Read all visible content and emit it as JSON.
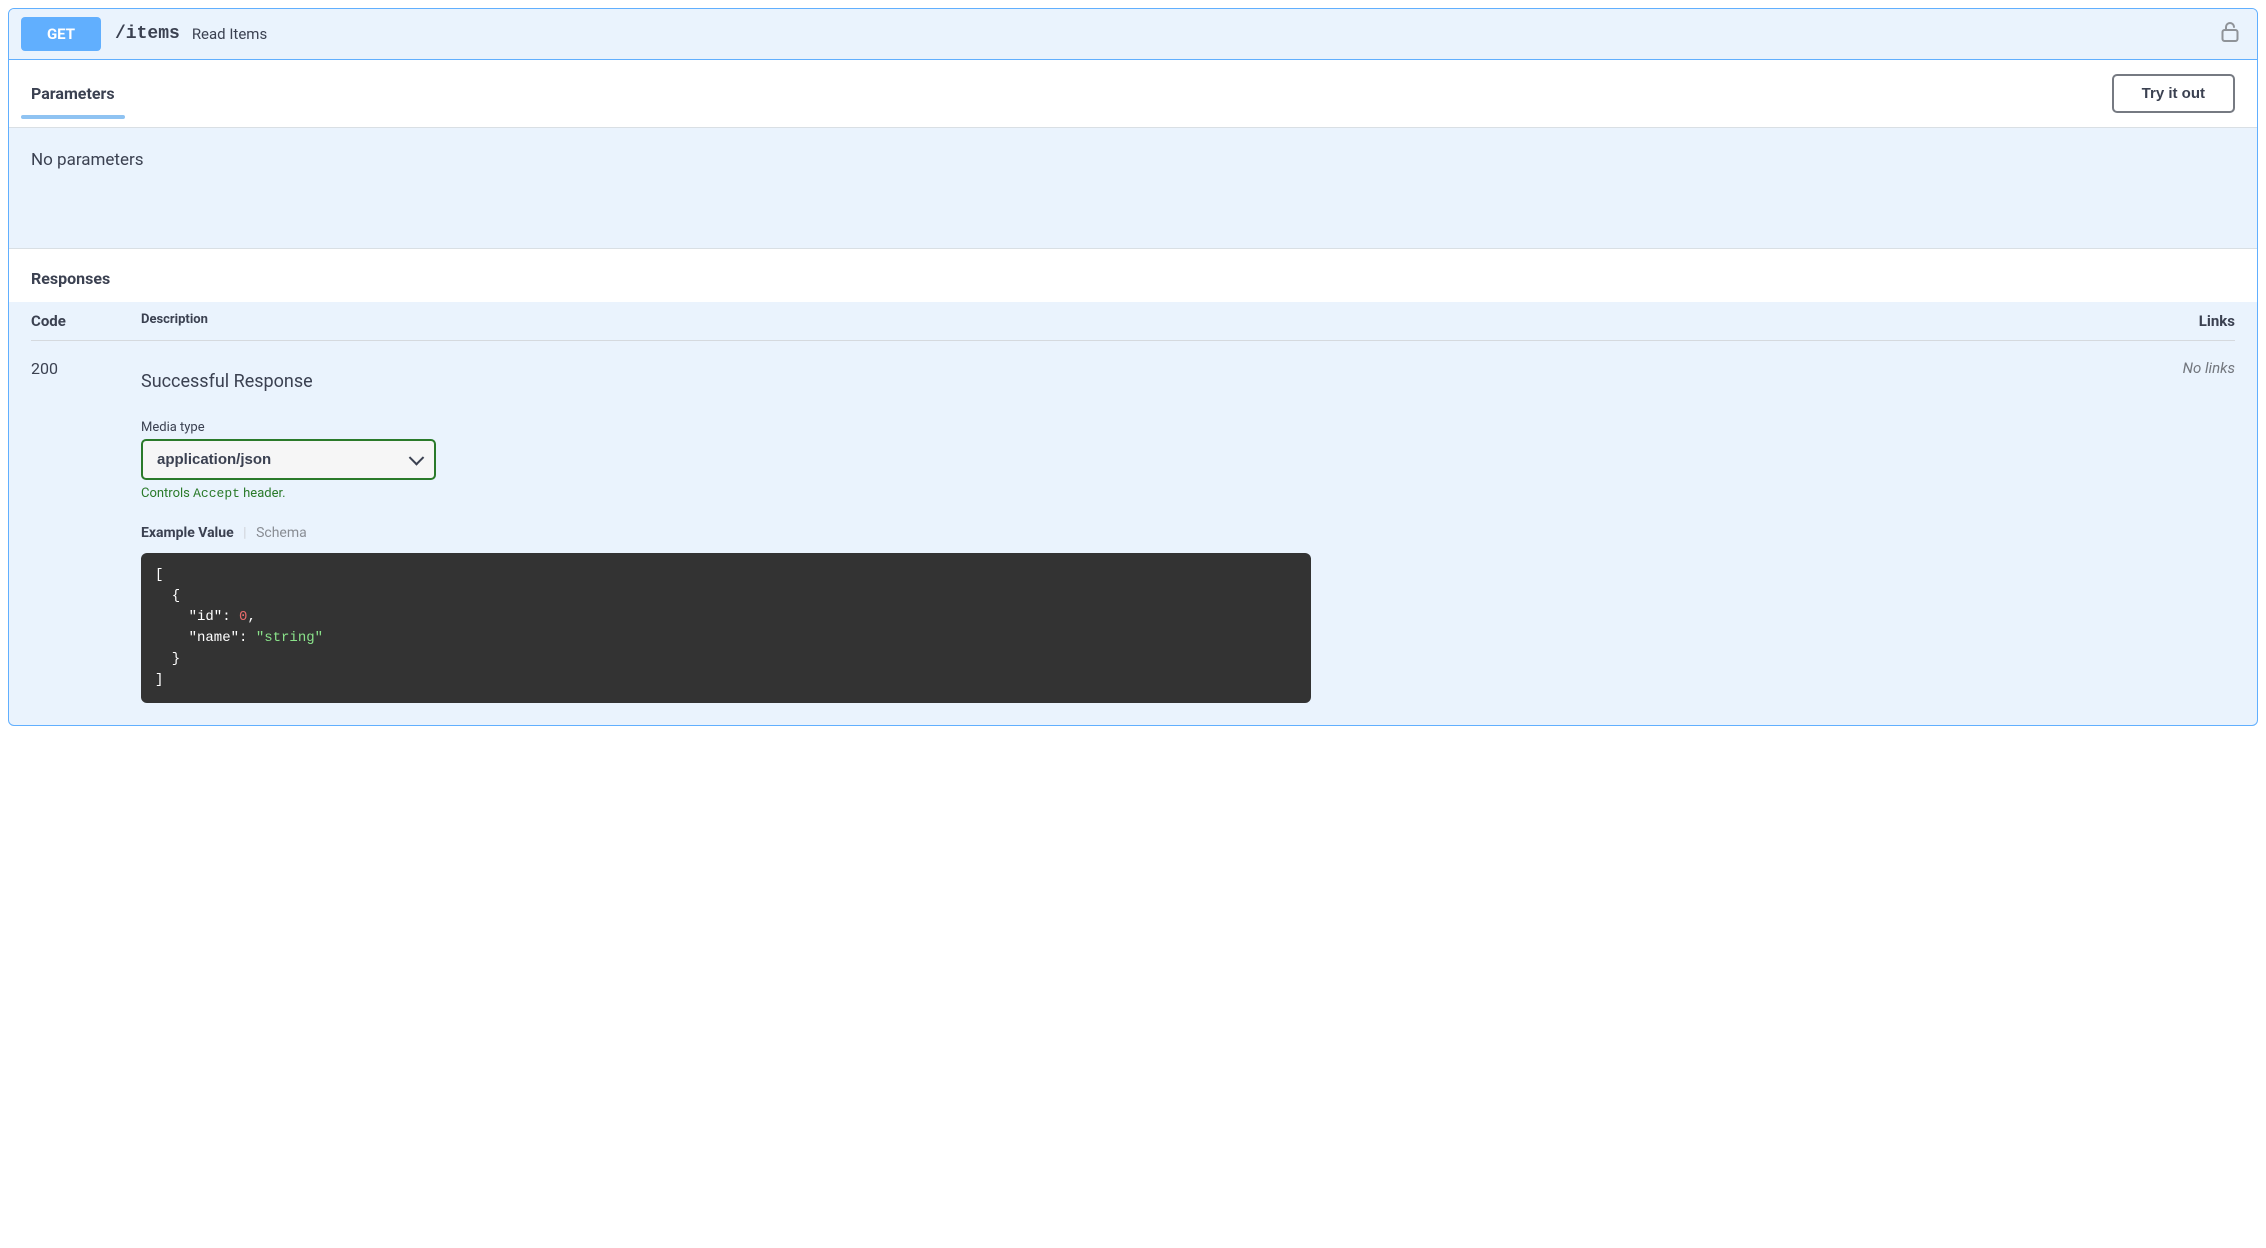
{
  "endpoint": {
    "method": "GET",
    "path": "/items",
    "summary": "Read Items"
  },
  "parameters": {
    "title": "Parameters",
    "try_label": "Try it out",
    "empty_text": "No parameters"
  },
  "responses": {
    "title": "Responses",
    "headers": {
      "code": "Code",
      "description": "Description",
      "links": "Links"
    },
    "items": [
      {
        "code": "200",
        "description": "Successful Response",
        "media_type_label": "Media type",
        "media_type_value": "application/json",
        "accept_note_prefix": "Controls ",
        "accept_note_code": "Accept",
        "accept_note_suffix": " header.",
        "example_tab": "Example Value",
        "schema_tab": "Schema",
        "example_lines": {
          "l1": "[",
          "l2": "  {",
          "l3a": "    \"id\"",
          "l3b": ": ",
          "l3c": "0",
          "l3d": ",",
          "l4a": "    \"name\"",
          "l4b": ": ",
          "l4c": "\"string\"",
          "l5": "  }",
          "l6": "]"
        },
        "links": "No links"
      }
    ]
  }
}
